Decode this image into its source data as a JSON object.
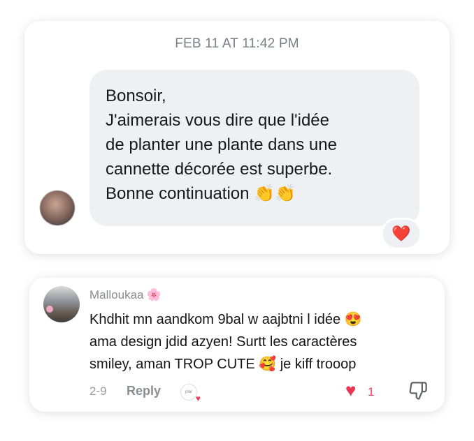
{
  "message": {
    "timestamp": "FEB 11 AT 11:42 PM",
    "text": "Bonsoir,\nJ'aimerais vous dire que l'idée\nde planter une plante dans une\ncannette décorée est superbe.\nBonne continuation 👏👏",
    "reaction": "❤️"
  },
  "comment": {
    "username": "Malloukaa",
    "username_emoji": "🌸",
    "text": "Khdhit mn aandkom 9bal w aajbtni l idée 😍\nama design jdid azyen! Surtt les caractères\nsmiley, aman TROP CUTE 🥰 je kiff trooop",
    "date": "2-9",
    "reply_label": "Reply",
    "creator_badge_text": "plar",
    "like_icon": "heart-filled-icon",
    "like_count": "1",
    "dislike_icon": "thumbs-down-icon",
    "accent_color": "#ea3656"
  }
}
